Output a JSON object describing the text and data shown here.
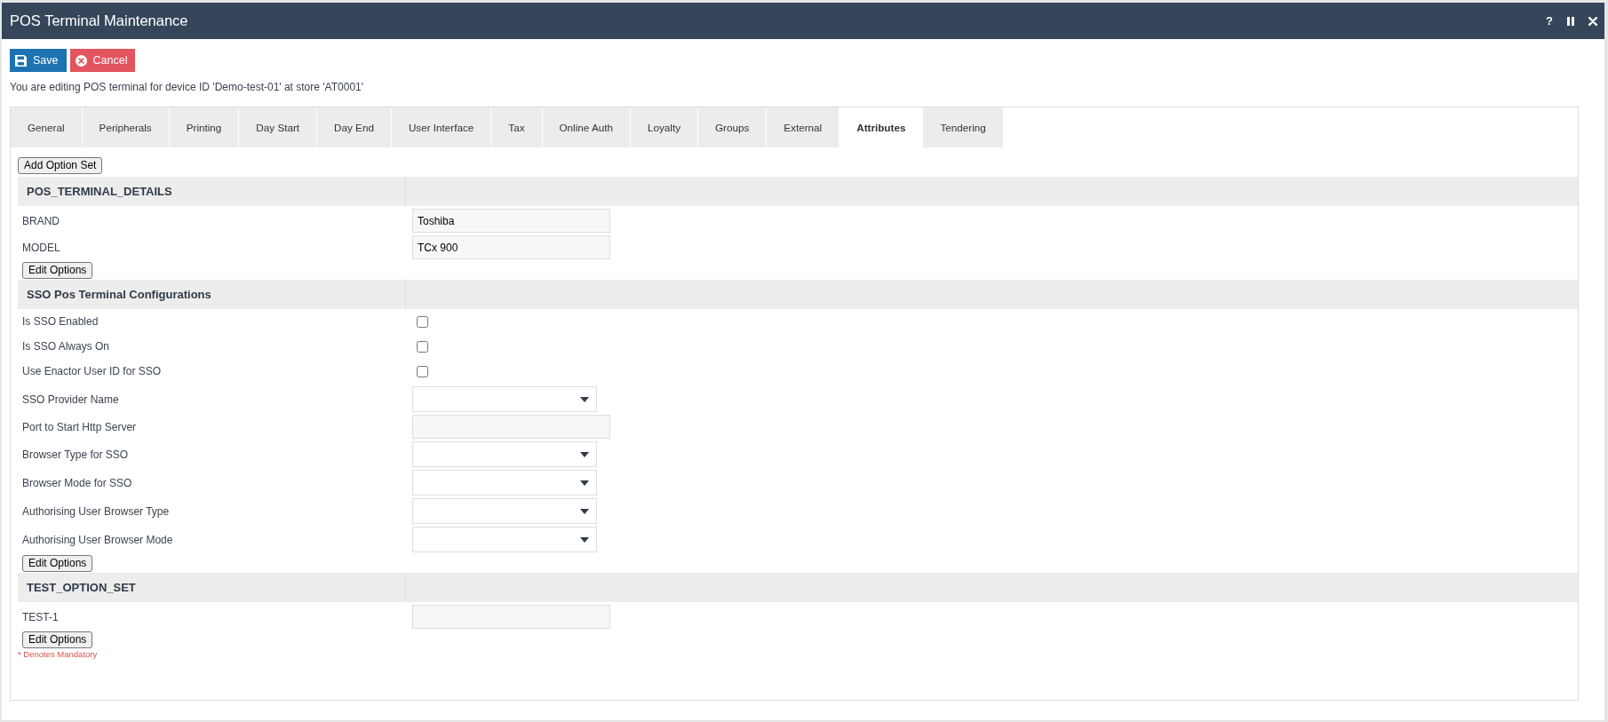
{
  "window": {
    "title": "POS Terminal Maintenance",
    "help": "?"
  },
  "toolbar": [
    {
      "kind": "save",
      "label": "Save"
    },
    {
      "kind": "cancel",
      "label": "Cancel"
    }
  ],
  "message": "You are editing POS terminal for device ID 'Demo-test-01' at store 'AT0001'",
  "tabs": [
    {
      "label": "General",
      "selected": false
    },
    {
      "label": "Peripherals",
      "selected": false
    },
    {
      "label": "Printing",
      "selected": false
    },
    {
      "label": "Day Start",
      "selected": false
    },
    {
      "label": "Day End",
      "selected": false
    },
    {
      "label": "User Interface",
      "selected": false
    },
    {
      "label": "Tax",
      "selected": false
    },
    {
      "label": "Online Auth",
      "selected": false
    },
    {
      "label": "Loyalty",
      "selected": false
    },
    {
      "label": "Groups",
      "selected": false
    },
    {
      "label": "External",
      "selected": false
    },
    {
      "label": "Attributes",
      "selected": true
    },
    {
      "label": "Tendering",
      "selected": false
    }
  ],
  "add_button": "Add Option Set",
  "option_sets": [
    {
      "title": "POS_TERMINAL_DETAILS",
      "fields": [
        {
          "kind": "text",
          "label": "BRAND",
          "value": "Toshiba"
        },
        {
          "kind": "text",
          "label": "MODEL",
          "value": "TCx 900"
        }
      ],
      "edit_button": "Edit Options"
    },
    {
      "title": "SSO Pos Terminal Configurations",
      "fields": [
        {
          "kind": "checkbox",
          "label": "Is SSO Enabled",
          "checked": false
        },
        {
          "kind": "checkbox",
          "label": "Is SSO Always On",
          "checked": false
        },
        {
          "kind": "checkbox",
          "label": "Use Enactor User ID for SSO",
          "checked": false
        },
        {
          "kind": "select",
          "label": "SSO Provider Name"
        },
        {
          "kind": "text",
          "label": "Port to Start Http Server"
        },
        {
          "kind": "select",
          "label": "Browser Type for SSO"
        },
        {
          "kind": "select",
          "label": "Browser Mode for SSO"
        },
        {
          "kind": "select",
          "label": "Authorising User Browser Type"
        },
        {
          "kind": "select",
          "label": "Authorising User Browser Mode"
        }
      ],
      "edit_button": "Edit Options"
    },
    {
      "title": "TEST_OPTION_SET",
      "fields": [
        {
          "kind": "text",
          "label": "TEST-1"
        }
      ],
      "edit_button": "Edit Options"
    }
  ],
  "footnote": "* Denotes Mandatory"
}
